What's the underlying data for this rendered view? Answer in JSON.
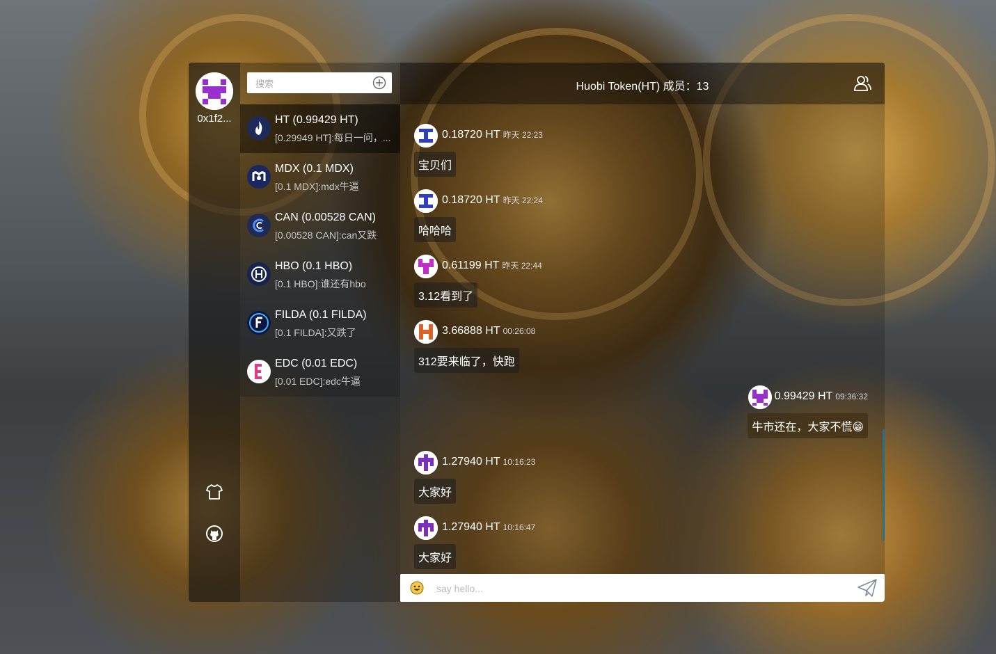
{
  "me": {
    "name": "0x1f2..."
  },
  "search": {
    "placeholder": "搜索"
  },
  "contacts": [
    {
      "title": "HT (0.99429 HT)",
      "last": "[0.29949 HT]:每日一问，...",
      "icon": "huobi-flame-icon",
      "color": "#1d2a5a"
    },
    {
      "title": "MDX (0.1 MDX)",
      "last": "[0.1 MDX]:mdx牛逼",
      "icon": "mdex-logo-icon",
      "color": "#1b2760"
    },
    {
      "title": "CAN (0.00528 CAN)",
      "last": "[0.00528 CAN]:can又跌",
      "icon": "channels-logo-icon",
      "color": "#1f2a55"
    },
    {
      "title": "HBO (0.1 HBO)",
      "last": "[0.1 HBO]:谁还有hbo",
      "icon": "hbo-logo-icon",
      "color": "#16244f"
    },
    {
      "title": "FILDA (0.1 FILDA)",
      "last": "[0.1 FILDA]:又跌了",
      "icon": "filda-logo-icon",
      "color": "#0d1640"
    },
    {
      "title": "EDC (0.01 EDC)",
      "last": "[0.01 EDC]:edc牛逼",
      "icon": "edc-logo-icon",
      "color": "#e23a86"
    }
  ],
  "chat": {
    "title": "Huobi Token(HT) 成员：13",
    "messages": [
      {
        "amount": "0.18720 HT",
        "time": "昨天 22:23",
        "text": "宝贝们",
        "avatar_color": "#2f3fc0",
        "mine": false
      },
      {
        "amount": "0.18720 HT",
        "time": "昨天 22:24",
        "text": "哈哈哈",
        "avatar_color": "#2f3fc0",
        "mine": false
      },
      {
        "amount": "0.61199 HT",
        "time": "昨天 22:44",
        "text": "3.12看到了",
        "avatar_color": "#c02fc8",
        "mine": false
      },
      {
        "amount": "3.66888 HT",
        "time": "00:26:08",
        "text": "312要来临了，快跑",
        "avatar_color": "#d9642a",
        "mine": false
      },
      {
        "amount": "0.99429 HT",
        "time": "09:36:32",
        "text": "牛市还在，大家不慌😁",
        "avatar_color": "#9a2fd0",
        "mine": true
      },
      {
        "amount": "1.27940 HT",
        "time": "10:16:23",
        "text": "大家好",
        "avatar_color": "#7b2fc0",
        "mine": false
      },
      {
        "amount": "1.27940 HT",
        "time": "10:16:47",
        "text": "大家好",
        "avatar_color": "#7b2fc0",
        "mine": false
      }
    ],
    "input_placeholder": "say hello..."
  },
  "icons": {
    "skin": "tshirt-icon",
    "github": "github-icon",
    "members": "members-icon",
    "emoji": "emoji-icon",
    "send": "paper-plane-icon",
    "add": "add-circle-icon"
  }
}
